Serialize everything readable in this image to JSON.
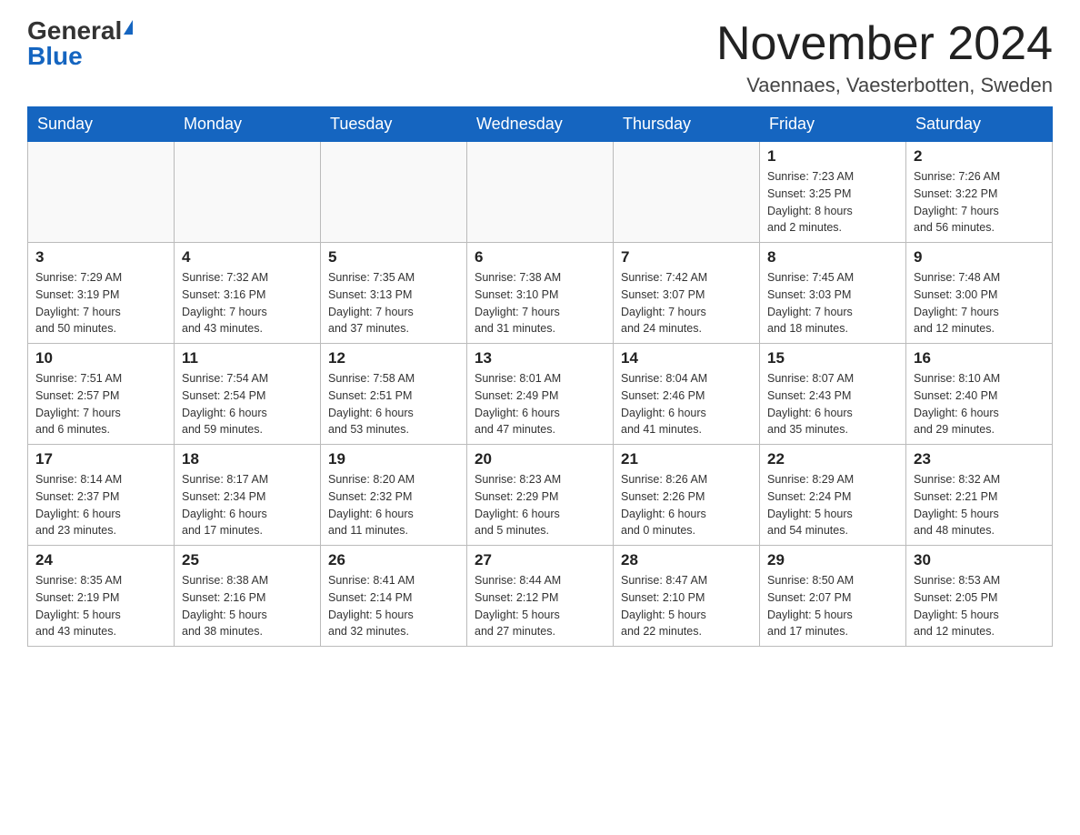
{
  "logo": {
    "general": "General",
    "blue": "Blue"
  },
  "header": {
    "month": "November 2024",
    "location": "Vaennaes, Vaesterbotten, Sweden"
  },
  "days_of_week": [
    "Sunday",
    "Monday",
    "Tuesday",
    "Wednesday",
    "Thursday",
    "Friday",
    "Saturday"
  ],
  "weeks": [
    [
      {
        "day": "",
        "info": ""
      },
      {
        "day": "",
        "info": ""
      },
      {
        "day": "",
        "info": ""
      },
      {
        "day": "",
        "info": ""
      },
      {
        "day": "",
        "info": ""
      },
      {
        "day": "1",
        "info": "Sunrise: 7:23 AM\nSunset: 3:25 PM\nDaylight: 8 hours\nand 2 minutes."
      },
      {
        "day": "2",
        "info": "Sunrise: 7:26 AM\nSunset: 3:22 PM\nDaylight: 7 hours\nand 56 minutes."
      }
    ],
    [
      {
        "day": "3",
        "info": "Sunrise: 7:29 AM\nSunset: 3:19 PM\nDaylight: 7 hours\nand 50 minutes."
      },
      {
        "day": "4",
        "info": "Sunrise: 7:32 AM\nSunset: 3:16 PM\nDaylight: 7 hours\nand 43 minutes."
      },
      {
        "day": "5",
        "info": "Sunrise: 7:35 AM\nSunset: 3:13 PM\nDaylight: 7 hours\nand 37 minutes."
      },
      {
        "day": "6",
        "info": "Sunrise: 7:38 AM\nSunset: 3:10 PM\nDaylight: 7 hours\nand 31 minutes."
      },
      {
        "day": "7",
        "info": "Sunrise: 7:42 AM\nSunset: 3:07 PM\nDaylight: 7 hours\nand 24 minutes."
      },
      {
        "day": "8",
        "info": "Sunrise: 7:45 AM\nSunset: 3:03 PM\nDaylight: 7 hours\nand 18 minutes."
      },
      {
        "day": "9",
        "info": "Sunrise: 7:48 AM\nSunset: 3:00 PM\nDaylight: 7 hours\nand 12 minutes."
      }
    ],
    [
      {
        "day": "10",
        "info": "Sunrise: 7:51 AM\nSunset: 2:57 PM\nDaylight: 7 hours\nand 6 minutes."
      },
      {
        "day": "11",
        "info": "Sunrise: 7:54 AM\nSunset: 2:54 PM\nDaylight: 6 hours\nand 59 minutes."
      },
      {
        "day": "12",
        "info": "Sunrise: 7:58 AM\nSunset: 2:51 PM\nDaylight: 6 hours\nand 53 minutes."
      },
      {
        "day": "13",
        "info": "Sunrise: 8:01 AM\nSunset: 2:49 PM\nDaylight: 6 hours\nand 47 minutes."
      },
      {
        "day": "14",
        "info": "Sunrise: 8:04 AM\nSunset: 2:46 PM\nDaylight: 6 hours\nand 41 minutes."
      },
      {
        "day": "15",
        "info": "Sunrise: 8:07 AM\nSunset: 2:43 PM\nDaylight: 6 hours\nand 35 minutes."
      },
      {
        "day": "16",
        "info": "Sunrise: 8:10 AM\nSunset: 2:40 PM\nDaylight: 6 hours\nand 29 minutes."
      }
    ],
    [
      {
        "day": "17",
        "info": "Sunrise: 8:14 AM\nSunset: 2:37 PM\nDaylight: 6 hours\nand 23 minutes."
      },
      {
        "day": "18",
        "info": "Sunrise: 8:17 AM\nSunset: 2:34 PM\nDaylight: 6 hours\nand 17 minutes."
      },
      {
        "day": "19",
        "info": "Sunrise: 8:20 AM\nSunset: 2:32 PM\nDaylight: 6 hours\nand 11 minutes."
      },
      {
        "day": "20",
        "info": "Sunrise: 8:23 AM\nSunset: 2:29 PM\nDaylight: 6 hours\nand 5 minutes."
      },
      {
        "day": "21",
        "info": "Sunrise: 8:26 AM\nSunset: 2:26 PM\nDaylight: 6 hours\nand 0 minutes."
      },
      {
        "day": "22",
        "info": "Sunrise: 8:29 AM\nSunset: 2:24 PM\nDaylight: 5 hours\nand 54 minutes."
      },
      {
        "day": "23",
        "info": "Sunrise: 8:32 AM\nSunset: 2:21 PM\nDaylight: 5 hours\nand 48 minutes."
      }
    ],
    [
      {
        "day": "24",
        "info": "Sunrise: 8:35 AM\nSunset: 2:19 PM\nDaylight: 5 hours\nand 43 minutes."
      },
      {
        "day": "25",
        "info": "Sunrise: 8:38 AM\nSunset: 2:16 PM\nDaylight: 5 hours\nand 38 minutes."
      },
      {
        "day": "26",
        "info": "Sunrise: 8:41 AM\nSunset: 2:14 PM\nDaylight: 5 hours\nand 32 minutes."
      },
      {
        "day": "27",
        "info": "Sunrise: 8:44 AM\nSunset: 2:12 PM\nDaylight: 5 hours\nand 27 minutes."
      },
      {
        "day": "28",
        "info": "Sunrise: 8:47 AM\nSunset: 2:10 PM\nDaylight: 5 hours\nand 22 minutes."
      },
      {
        "day": "29",
        "info": "Sunrise: 8:50 AM\nSunset: 2:07 PM\nDaylight: 5 hours\nand 17 minutes."
      },
      {
        "day": "30",
        "info": "Sunrise: 8:53 AM\nSunset: 2:05 PM\nDaylight: 5 hours\nand 12 minutes."
      }
    ]
  ]
}
